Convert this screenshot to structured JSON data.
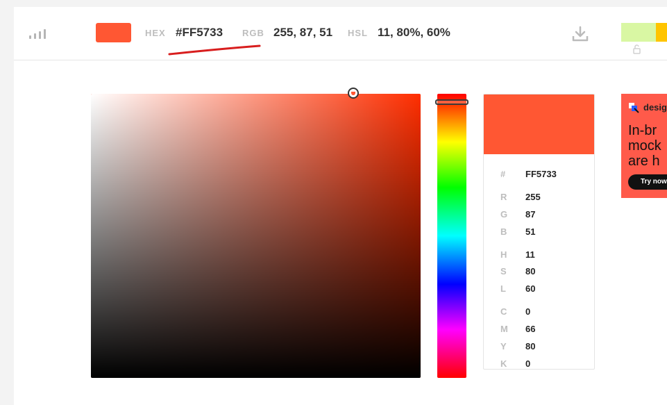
{
  "color": {
    "hex_label": "HEX",
    "hex_value": "#FF5733",
    "rgb_label": "RGB",
    "rgb_value": "255, 87, 51",
    "hsl_label": "HSL",
    "hsl_value": "11, 80%, 60%",
    "swatch_color": "#FF5733",
    "pure_hue_color": "#FF2E00"
  },
  "palette": [
    {
      "color": "#D9F7A3"
    },
    {
      "color": "#FFC400"
    }
  ],
  "details": [
    {
      "key": "#",
      "value": "FF5733"
    },
    {
      "key": "R",
      "value": "255"
    },
    {
      "key": "G",
      "value": "87"
    },
    {
      "key": "B",
      "value": "51"
    },
    {
      "key": "H",
      "value": "11"
    },
    {
      "key": "S",
      "value": "80"
    },
    {
      "key": "L",
      "value": "60"
    },
    {
      "key": "C",
      "value": "0"
    },
    {
      "key": "M",
      "value": "66"
    },
    {
      "key": "Y",
      "value": "80"
    },
    {
      "key": "K",
      "value": "0"
    }
  ],
  "ad": {
    "brand": "design",
    "headline": "In-br\nmock\nare h",
    "cta": "Try now"
  },
  "annotation": {
    "underline_color": "#D81E1E"
  }
}
